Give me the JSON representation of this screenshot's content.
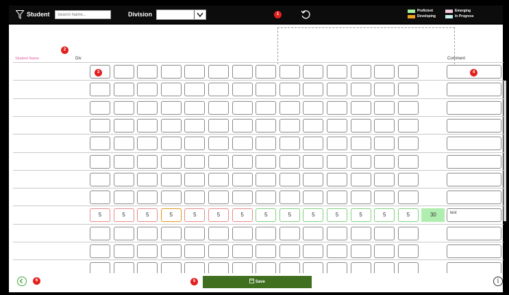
{
  "toolbar": {
    "student_label": "Student",
    "search_placeholder": "Search Name...",
    "division_label": "Division",
    "division_value": ""
  },
  "badges": [
    "1",
    "2",
    "3",
    "4",
    "5",
    "6"
  ],
  "legend": [
    {
      "label": "Proficient",
      "color": "#a8f0a0"
    },
    {
      "label": "Emerging",
      "color": "#f0c8dc"
    },
    {
      "label": "Developing",
      "color": "#f0a020"
    },
    {
      "label": "In Progress",
      "color": "#c8f0f0"
    }
  ],
  "grid": {
    "section_header": "",
    "student_header": "Student Name",
    "div_header": "Div",
    "comment_header": "Comment",
    "columns": [
      "",
      "",
      "",
      "",
      "",
      "",
      "",
      "",
      "",
      "",
      "",
      "",
      "",
      ""
    ],
    "total_column": "",
    "rows": [
      {
        "name": "",
        "div": "",
        "scores": [
          "",
          "",
          "",
          "",
          "",
          "",
          "",
          "",
          "",
          "",
          "",
          "",
          "",
          ""
        ],
        "total": "",
        "comment": ""
      },
      {
        "name": "",
        "div": "",
        "scores": [
          "",
          "",
          "",
          "",
          "",
          "",
          "",
          "",
          "",
          "",
          "",
          "",
          "",
          ""
        ],
        "total": "",
        "comment": ""
      },
      {
        "name": "",
        "div": "",
        "scores": [
          "",
          "",
          "",
          "",
          "",
          "",
          "",
          "",
          "",
          "",
          "",
          "",
          "",
          ""
        ],
        "total": "",
        "comment": ""
      },
      {
        "name": "",
        "div": "",
        "scores": [
          "",
          "",
          "",
          "",
          "",
          "",
          "",
          "",
          "",
          "",
          "",
          "",
          "",
          ""
        ],
        "total": "",
        "comment": ""
      },
      {
        "name": "",
        "div": "",
        "scores": [
          "",
          "",
          "",
          "",
          "",
          "",
          "",
          "",
          "",
          "",
          "",
          "",
          "",
          ""
        ],
        "total": "",
        "comment": ""
      },
      {
        "name": "",
        "div": "",
        "scores": [
          "",
          "",
          "",
          "",
          "",
          "",
          "",
          "",
          "",
          "",
          "",
          "",
          "",
          ""
        ],
        "total": "",
        "comment": ""
      },
      {
        "name": "",
        "div": "",
        "scores": [
          "",
          "",
          "",
          "",
          "",
          "",
          "",
          "",
          "",
          "",
          "",
          "",
          "",
          ""
        ],
        "total": "",
        "comment": ""
      },
      {
        "name": "",
        "div": "",
        "scores": [
          "",
          "",
          "",
          "",
          "",
          "",
          "",
          "",
          "",
          "",
          "",
          "",
          "",
          ""
        ],
        "total": "",
        "comment": ""
      },
      {
        "name": "",
        "div": "",
        "scores": [
          "5",
          "5",
          "5",
          "5",
          "5",
          "5",
          "5",
          "5",
          "5",
          "5",
          "5",
          "5",
          "5",
          "5"
        ],
        "total": "30",
        "comment": "test",
        "score_states": [
          "pink",
          "pink",
          "pink",
          "orange",
          "pink",
          "pink",
          "pink",
          "green",
          "green",
          "green",
          "green",
          "green",
          "green",
          "green"
        ]
      },
      {
        "name": "",
        "div": "",
        "scores": [
          "",
          "",
          "",
          "",
          "",
          "",
          "",
          "",
          "",
          "",
          "",
          "",
          "",
          ""
        ],
        "total": "",
        "comment": ""
      },
      {
        "name": "",
        "div": "",
        "scores": [
          "",
          "",
          "",
          "",
          "",
          "",
          "",
          "",
          "",
          "",
          "",
          "",
          "",
          ""
        ],
        "total": "",
        "comment": ""
      },
      {
        "name": "",
        "div": "",
        "scores": [
          "",
          "",
          "",
          "",
          "",
          "",
          "",
          "",
          "",
          "",
          "",
          "",
          "",
          ""
        ],
        "total": "",
        "comment": ""
      }
    ]
  },
  "footer": {
    "save_label": "Save",
    "info_label": "i"
  }
}
